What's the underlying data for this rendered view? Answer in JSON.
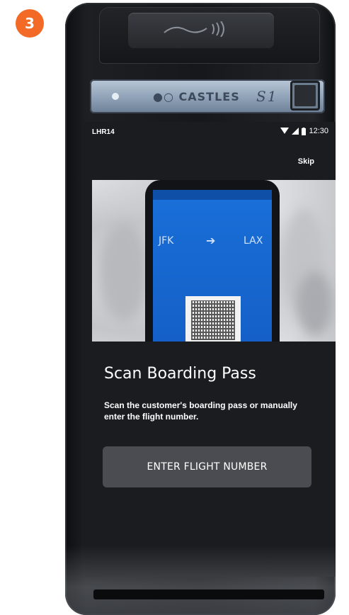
{
  "step": {
    "number": "3",
    "color": "#f26a26"
  },
  "device": {
    "brand": "CASTLES",
    "model": "S1",
    "nfc_icon": "contactless-icon",
    "camera_icon": "camera-icon"
  },
  "status_bar": {
    "left_label": "LHR14",
    "time": "12:30",
    "icons": [
      "wifi-icon",
      "signal-icon",
      "battery-icon"
    ]
  },
  "header": {
    "skip_label": "Skip"
  },
  "hero": {
    "image": "boarding-pass-on-phone",
    "origin": "JFK",
    "destination": "LAX"
  },
  "main": {
    "title": "Scan Boarding Pass",
    "description": "Scan the customer's boarding pass or manually enter the flight number.",
    "button_label": "ENTER FLIGHT NUMBER"
  },
  "colors": {
    "screen_bg": "#1b1c20",
    "button_bg": "#4a4c52",
    "boarding_pass_blue": "#1a6fd8"
  }
}
